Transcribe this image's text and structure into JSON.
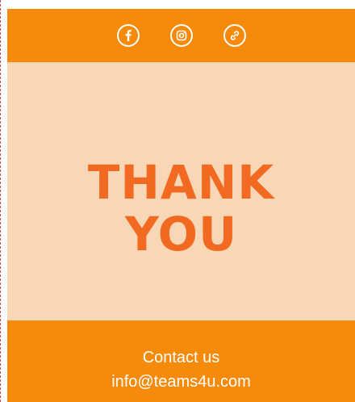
{
  "header": {
    "icons": [
      "facebook-icon",
      "instagram-icon",
      "link-icon"
    ],
    "colors": {
      "background": "#f58a0b",
      "icon": "#ffffff"
    }
  },
  "hero": {
    "title_line_1": "THANK",
    "title_line_2": "YOU",
    "colors": {
      "background": "#f7d7b6",
      "text": "#f26a21"
    }
  },
  "footer": {
    "contact_label": "Contact us",
    "email": "info@teams4u.com",
    "colors": {
      "background": "#f58a0b",
      "text": "#ffffff"
    }
  }
}
